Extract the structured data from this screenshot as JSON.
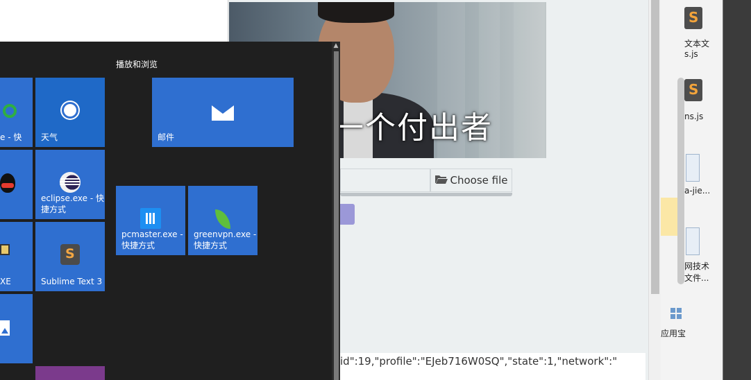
{
  "browser": {
    "photo_caption": "一个付出者",
    "choose_file_label": "Choose file",
    "json_preview": "id\":19,\"profile\":\"EJeb716W0SQ\",\"state\":1,\"network\":\""
  },
  "start_menu": {
    "group_title": "播放和浏览",
    "tiles": {
      "partial_top": "e - 快",
      "weather": "天气",
      "mail": "邮件",
      "eclipse_line1": "eclipse.exe - 快",
      "eclipse_line2": "捷方式",
      "pcmaster_line1": "pcmaster.exe -",
      "pcmaster_line2": "快捷方式",
      "greenvpn_line1": "greenvpn.exe -",
      "greenvpn_line2": "快捷方式",
      "partial_exe": "XE",
      "sublime": "Sublime Text 3"
    }
  },
  "desktop": {
    "icon1_line1": "文本文",
    "icon1_line2": "s.js",
    "icon2": "ns.js",
    "icon3": "a-jie...",
    "icon4_line1": "网技术",
    "icon4_line2": "文件...",
    "icon5": "应用宝"
  },
  "colors": {
    "tile_blue": "#2f6fd0",
    "start_bg": "#1f1f1f",
    "purple_tile": "#7b3a8c"
  }
}
